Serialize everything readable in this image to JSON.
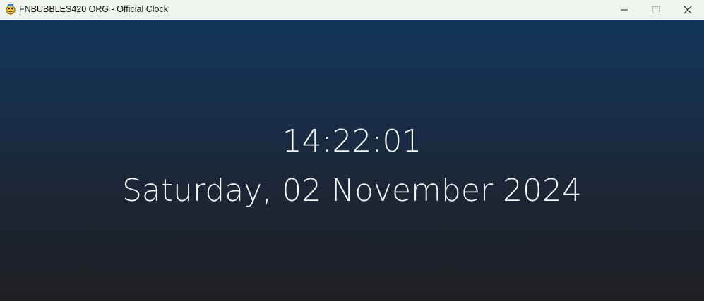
{
  "window": {
    "title": "FNBUBBLES420 ORG - Official Clock",
    "icon": "pygame-snake-icon",
    "controls": {
      "minimize": "minimize-icon",
      "maximize": "maximize-icon",
      "close": "close-icon"
    }
  },
  "clock": {
    "time": "14:22:01",
    "date": "Saturday, 02 November 2024"
  },
  "colors": {
    "titlebar_bg": "#eff5ec",
    "gradient_top": "#11345a",
    "gradient_bottom": "#1e1f21",
    "text": "#f4f6f8"
  }
}
